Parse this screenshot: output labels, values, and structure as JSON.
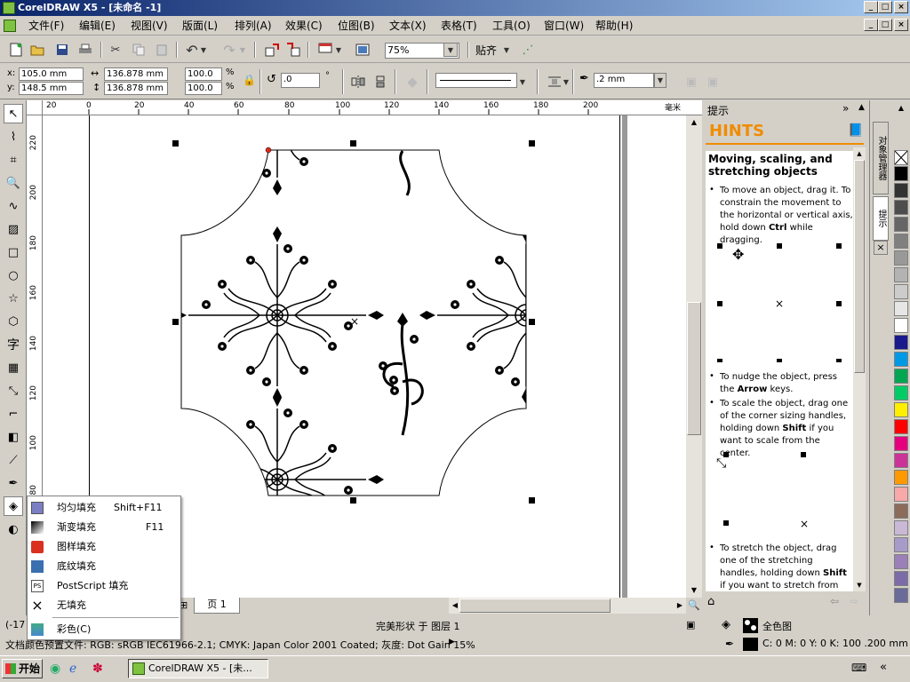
{
  "window": {
    "title": "CorelDRAW X5 - [未命名 -1]",
    "controls": [
      "_",
      "□",
      "×"
    ],
    "doc_controls": [
      "_",
      "□",
      "×"
    ]
  },
  "menu": [
    "文件(F)",
    "编辑(E)",
    "视图(V)",
    "版面(L)",
    "排列(A)",
    "效果(C)",
    "位图(B)",
    "文本(X)",
    "表格(T)",
    "工具(O)",
    "窗口(W)",
    "帮助(H)"
  ],
  "toolbar": {
    "zoom": "75%",
    "snap_label": "贴齐"
  },
  "property_bar": {
    "x_label": "x:",
    "x_value": "105.0 mm",
    "y_label": "y:",
    "y_value": "148.5 mm",
    "width_value": "136.878 mm",
    "height_value": "136.878 mm",
    "scale_x": "100.0",
    "scale_y": "100.0",
    "percent": "%",
    "rotation": ".0",
    "degree": "°",
    "outline_width": ".2 mm"
  },
  "hruler_ticks": [
    "20",
    "0",
    "20",
    "40",
    "60",
    "80",
    "100",
    "120",
    "140",
    "160",
    "180",
    "200"
  ],
  "hruler_unit": "毫米",
  "vruler_ticks": [
    "220",
    "200",
    "180",
    "160",
    "140",
    "120",
    "100",
    "80"
  ],
  "page_tabs": {
    "page_label": "页 1"
  },
  "status": {
    "coords": "(-17",
    "object_info": "完美形状 于 图层 1",
    "color_profile": "文档颜色预置文件: RGB: sRGB IEC61966-2.1; CMYK: Japan Color 2001 Coated; 灰度: Dot Gain 15%",
    "fill_label": "全色图",
    "outline_info": "C: 0 M: 0 Y: 0 K: 100  .200 mm"
  },
  "hints": {
    "panel_title": "提示",
    "logo": "HINTS",
    "heading": "Moving, scaling, and stretching objects",
    "p1": "To move an object, drag it. To constrain the movement to the horizontal or vertical axis, hold down",
    "p1_key": "Ctrl",
    "p1_tail": "while dragging.",
    "p2": "To nudge the object, press the",
    "p2_key": "Arrow",
    "p2_tail": "keys.",
    "p3": "To scale the object, drag one of the corner sizing handles, holding down",
    "p3_key": "Shift",
    "p3_tail": "if you want to scale from the center.",
    "p4": "To stretch the object, drag one of the stretching handles, holding down",
    "p4_key": "Shift",
    "p4_tail": "if you want to stretch from the"
  },
  "side_tabs": [
    "对象管理器",
    "提示"
  ],
  "fill_popup": [
    {
      "label": "均匀填充",
      "shortcut": "Shift+F11",
      "icon": "uniform-fill-icon"
    },
    {
      "label": "渐变填充",
      "shortcut": "F11",
      "icon": "fountain-fill-icon"
    },
    {
      "label": "图样填充",
      "shortcut": "",
      "icon": "pattern-fill-icon"
    },
    {
      "label": "底纹填充",
      "shortcut": "",
      "icon": "texture-fill-icon"
    },
    {
      "label": "PostScript 填充",
      "shortcut": "",
      "icon": "postscript-fill-icon"
    },
    {
      "label": "无填充",
      "shortcut": "",
      "icon": "no-fill-icon"
    },
    {
      "label": "彩色(C)",
      "shortcut": "",
      "icon": "color-docker-icon"
    }
  ],
  "palette": [
    "#000000",
    "#333333",
    "#4d4d4d",
    "#666666",
    "#808080",
    "#999999",
    "#b3b3b3",
    "#cccccc",
    "#e6e6e6",
    "#ffffff",
    "#1a1a8c",
    "#0099e6",
    "#00a651",
    "#00cc66",
    "#ffee00",
    "#ff0000",
    "#e6007e",
    "#cc3399",
    "#ff9900",
    "#f7a8a8",
    "#8c6b5a",
    "#c9b8d6",
    "#a89bc9",
    "#9b7fb8",
    "#7b6ca8",
    "#6b6b99"
  ],
  "taskbar": {
    "start": "开始",
    "task": "CorelDRAW X5 - [未..."
  }
}
